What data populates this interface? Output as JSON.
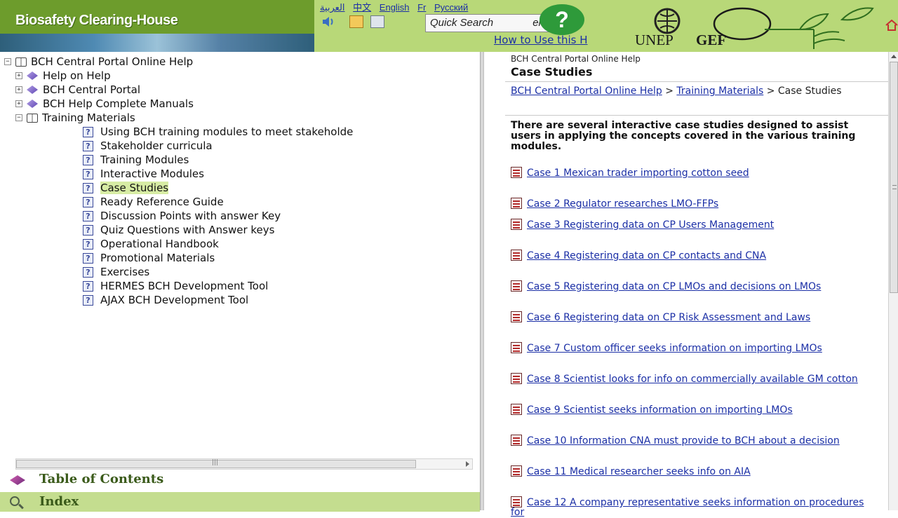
{
  "header": {
    "brand": "Biosafety Clearing-House",
    "quick_search": "Quick Search",
    "quick_search_partial": "ent scr",
    "languages": [
      "العربية",
      "中文",
      "English",
      "Fr",
      "Русский"
    ],
    "how_to": "How to Use this H",
    "help_glyph": "?",
    "unep": "UNEP",
    "gef": "GEF"
  },
  "tree": {
    "root": "BCH Central Portal Online Help",
    "items": [
      {
        "label": "Help on Help",
        "level": 1,
        "kind": "diamond",
        "toggle": "+"
      },
      {
        "label": "BCH Central Portal",
        "level": 1,
        "kind": "diamond",
        "toggle": "+"
      },
      {
        "label": "BCH Help Complete Manuals",
        "level": 1,
        "kind": "diamond",
        "toggle": "+"
      },
      {
        "label": "Training Materials",
        "level": 1,
        "kind": "book",
        "toggle": "−"
      },
      {
        "label": "Using BCH training modules to meet stakeholde",
        "level": 2
      },
      {
        "label": "Stakeholder curricula",
        "level": 2
      },
      {
        "label": "Training Modules",
        "level": 2
      },
      {
        "label": "Interactive Modules",
        "level": 2
      },
      {
        "label": "Case Studies",
        "level": 2,
        "selected": true
      },
      {
        "label": "Ready Reference Guide",
        "level": 2
      },
      {
        "label": "Discussion Points with answer Key",
        "level": 2
      },
      {
        "label": "Quiz Questions with Answer keys",
        "level": 2
      },
      {
        "label": "Operational Handbook",
        "level": 2
      },
      {
        "label": "Promotional Materials",
        "level": 2
      },
      {
        "label": "Exercises",
        "level": 2
      },
      {
        "label": "HERMES BCH Development Tool",
        "level": 2
      },
      {
        "label": "AJAX BCH Development Tool",
        "level": 2
      }
    ],
    "hscroll_mark": "|||",
    "tabs": {
      "toc": "Table of Contents",
      "index": "Index"
    }
  },
  "content": {
    "top_crumb": "BCH Central Portal Online Help",
    "title": "Case Studies",
    "breadcrumb": {
      "link1": "BCH Central Portal Online Help",
      "sep1": " > ",
      "link2": "Training Materials",
      "sep2": " > ",
      "current": "Case Studies"
    },
    "intro": "There are several interactive case studies designed to assist users in applying the concepts covered in the various training modules.",
    "cases": [
      "Case 1 Mexican trader importing cotton seed",
      "Case 2 Regulator researches LMO-FFPs",
      "Case 3 Registering data on CP Users Management",
      "Case 4 Registering data on CP contacts and CNA",
      "Case 5 Registering data on CP LMOs and decisions on LMOs",
      "Case 6 Registering data on CP Risk Assessment and Laws",
      "Case 7 Custom officer seeks information on importing LMOs",
      "Case 8 Scientist looks for info on commercially available GM cotton",
      "Case 9 Scientist seeks information on importing LMOs",
      "Case 10 Information CNA must provide to BCH about a decision",
      "Case 11 Medical researcher seeks info on AIA",
      "Case 12 A company representative seeks information on procedures for"
    ]
  }
}
